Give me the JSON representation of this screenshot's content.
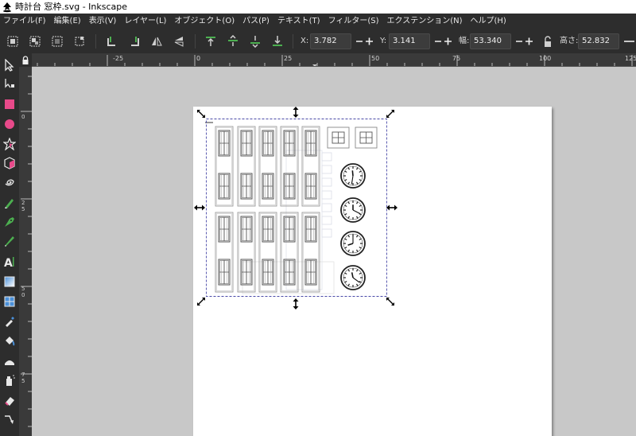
{
  "window": {
    "title": "時計台 窓枠.svg - Inkscape"
  },
  "menu": [
    "ファイル(F)",
    "編集(E)",
    "表示(V)",
    "レイヤー(L)",
    "オブジェクト(O)",
    "パス(P)",
    "テキスト(T)",
    "フィルター(S)",
    "エクステンション(N)",
    "ヘルプ(H)"
  ],
  "toolbar": {
    "x_label": "X:",
    "x_value": "3.782",
    "y_label": "Y:",
    "y_value": "3.141",
    "w_label": "幅:",
    "w_value": "53.340",
    "h_label": "高さ:",
    "h_value": "52.832",
    "icons": [
      "select-all-icon",
      "select-all-layers-icon",
      "deselect-icon",
      "touch-select-icon",
      "rotate-ccw-icon",
      "rotate-cw-icon",
      "flip-horizontal-icon",
      "flip-vertical-icon",
      "raise-to-top-icon",
      "raise-icon",
      "lower-icon",
      "lower-to-bottom-icon"
    ]
  },
  "hruler": {
    "labels": [
      "-25",
      "0",
      "25",
      "50",
      "75",
      "100",
      "125"
    ]
  },
  "vruler": {
    "labels": [
      "0",
      "2\n5",
      "5\n0",
      "7\n5"
    ]
  },
  "tools": [
    "selector-tool-icon",
    "node-tool-icon",
    "rectangle-tool-icon",
    "ellipse-tool-icon",
    "star-tool-icon",
    "3d-box-tool-icon",
    "spiral-tool-icon",
    "pencil-tool-icon",
    "pen-tool-icon",
    "calligraphy-tool-icon",
    "text-tool-icon",
    "gradient-tool-icon",
    "mesh-tool-icon",
    "dropper-tool-icon",
    "paint-bucket-tool-icon",
    "tweak-tool-icon",
    "spray-tool-icon",
    "eraser-tool-icon",
    "connector-tool-icon"
  ],
  "colors": {
    "accent_pink": "#e84a8a",
    "selection_dash": "#4a4aa8",
    "canvas_bg": "#c8c8c8",
    "chrome": "#2d2d2d"
  }
}
